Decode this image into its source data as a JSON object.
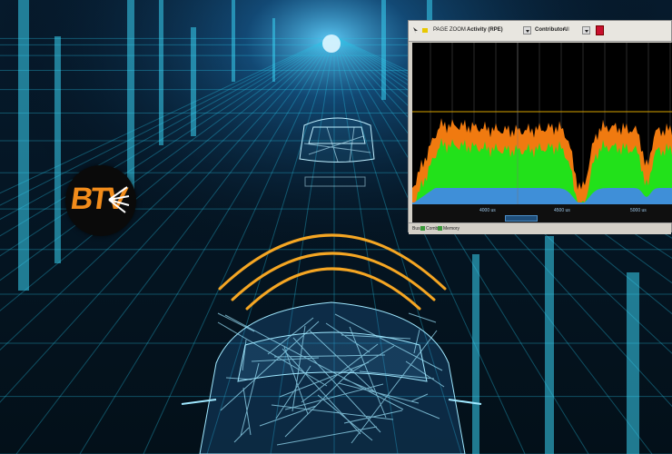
{
  "logo": {
    "text": "BTV",
    "accent": "#f28c1b"
  },
  "overlay_window": {
    "toolbar": {
      "zoom_label": "PAGE ZOOM",
      "metric_select": "Activity (RPE)",
      "contributor_label": "Contributor:",
      "contributor_value": "All"
    },
    "x_axis_ticks": [
      "4000 us",
      "4500 us",
      "5000 us"
    ],
    "status_items": [
      "Bus",
      "Comb",
      "Memory"
    ],
    "colors": {
      "activity_high": "#22e11a",
      "activity_peak": "#f07a10",
      "baseline": "#3f8fd8",
      "limit_line": "#d9a400"
    }
  },
  "scene": {
    "colors": {
      "grid": "#29c3e6",
      "arcs": "#f5a623"
    }
  }
}
